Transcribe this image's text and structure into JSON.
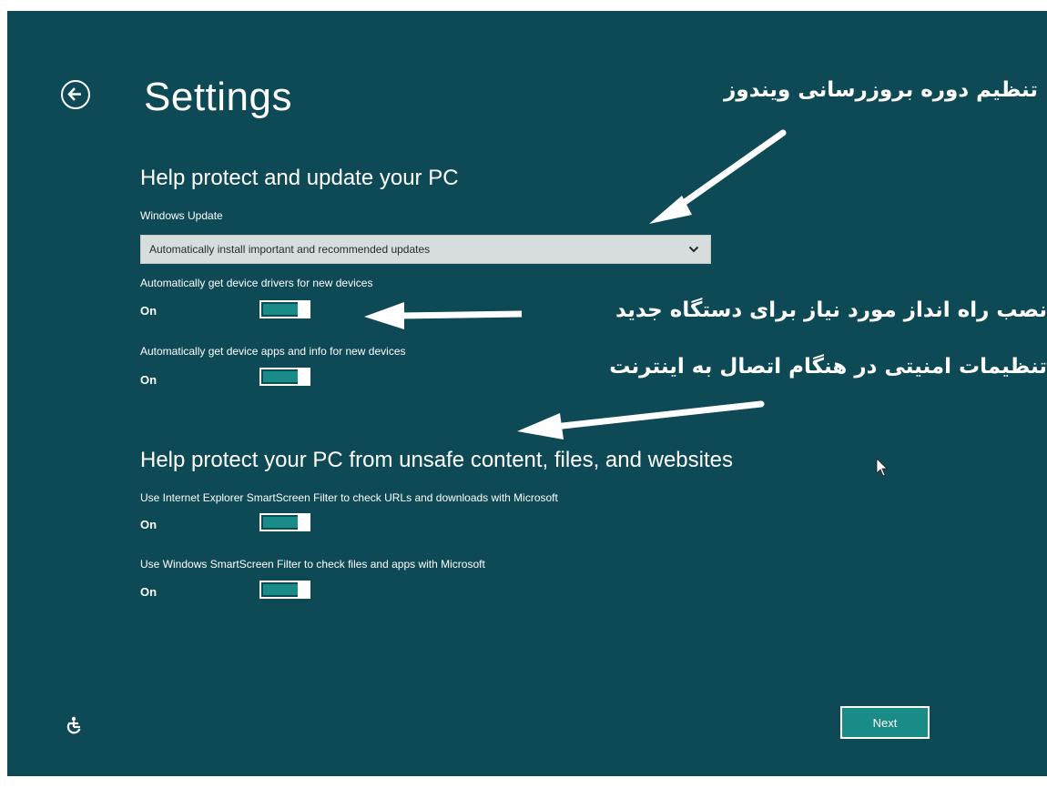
{
  "header": {
    "title": "Settings",
    "back_icon": "back-arrow-icon"
  },
  "section1": {
    "heading": "Help protect and update your PC",
    "windows_update_label": "Windows Update",
    "windows_update_value": "Automatically install important and recommended updates",
    "setting_drivers_label": "Automatically get device drivers for new devices",
    "setting_drivers_state": "On",
    "setting_apps_label": "Automatically get device apps and info for new devices",
    "setting_apps_state": "On"
  },
  "section2": {
    "heading": "Help protect your PC from unsafe content, files, and websites",
    "ie_filter_label": "Use Internet Explorer SmartScreen Filter to check URLs and downloads with Microsoft",
    "ie_filter_state": "On",
    "win_filter_label": "Use Windows SmartScreen Filter to check files and apps with Microsoft",
    "win_filter_state": "On"
  },
  "annotations": {
    "update_period": "تنظیم دوره بروزرسانی ویندوز",
    "driver_install": "نصب راه انداز مورد نیاز برای دستگاه جدید",
    "security_settings": "تنظیمات امنیتی در هنگام اتصال به اینترنت"
  },
  "footer": {
    "next_label": "Next",
    "accessibility_icon": "ease-of-access-icon"
  },
  "colors": {
    "background": "#0e4a56",
    "accent": "#1a8c87",
    "text": "#ffffff"
  }
}
